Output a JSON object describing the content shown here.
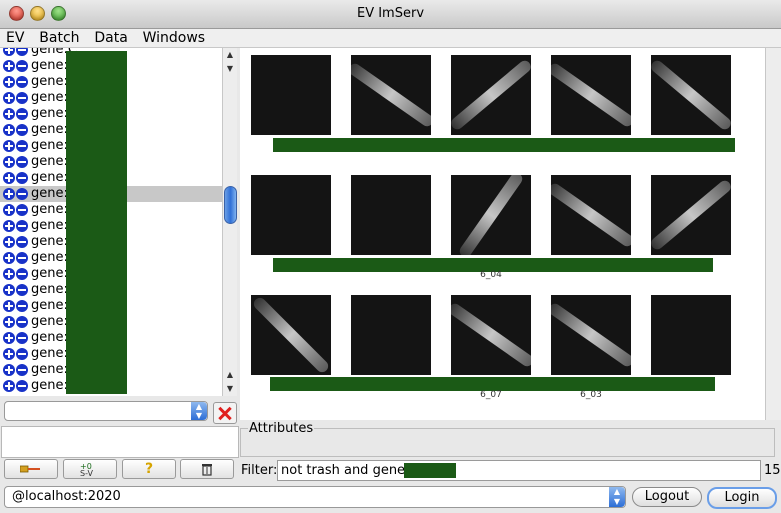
{
  "window": {
    "title": "EV ImServ"
  },
  "menu": [
    "EV",
    "Batch",
    "Data",
    "Windows"
  ],
  "gene_list": {
    "rows": [
      {
        "label": "gene:C",
        "selected": false
      },
      {
        "label": "gene:C",
        "selected": false
      },
      {
        "label": "gene:C",
        "selected": false
      },
      {
        "label": "gene:C",
        "selected": false
      },
      {
        "label": "gene:C",
        "selected": false
      },
      {
        "label": "gene:C",
        "selected": false
      },
      {
        "label": "gene:C",
        "selected": false
      },
      {
        "label": "gene:C",
        "selected": false
      },
      {
        "label": "gene:C",
        "selected": false
      },
      {
        "label": "gene:E",
        "selected": true
      },
      {
        "label": "gene:E",
        "selected": false
      },
      {
        "label": "gene:E",
        "selected": false
      },
      {
        "label": "gene:E",
        "selected": false
      },
      {
        "label": "gene:E",
        "selected": false
      },
      {
        "label": "gene:E",
        "selected": false
      },
      {
        "label": "gene:E",
        "selected": false
      },
      {
        "label": "gene:E",
        "selected": false
      },
      {
        "label": "gene:E",
        "selected": false
      },
      {
        "label": "gene:E",
        "selected": false
      },
      {
        "label": "gene:E",
        "selected": false
      },
      {
        "label": "gene:E",
        "selected": false
      },
      {
        "label": "gene:E",
        "selected": false
      }
    ]
  },
  "thumbnails": {
    "row_captions": [
      "",
      "6_04",
      "6_07",
      "6_03"
    ],
    "images": [
      {
        "worm": false,
        "angle": 0
      },
      {
        "worm": true,
        "angle": 35
      },
      {
        "worm": true,
        "angle": -40
      },
      {
        "worm": true,
        "angle": 35
      },
      {
        "worm": true,
        "angle": 40
      },
      {
        "worm": false,
        "angle": 0
      },
      {
        "worm": false,
        "angle": 0
      },
      {
        "worm": true,
        "angle": -55
      },
      {
        "worm": true,
        "angle": 35
      },
      {
        "worm": true,
        "angle": -40
      },
      {
        "worm": true,
        "angle": 45
      },
      {
        "worm": false,
        "angle": 0
      },
      {
        "worm": true,
        "angle": 35
      },
      {
        "worm": true,
        "angle": 35
      },
      {
        "worm": false,
        "angle": 0
      }
    ]
  },
  "attributes": {
    "title": "Attributes"
  },
  "toolbar": {
    "tag_icon": "tag-icon",
    "sort_icon": "sort-icon",
    "help_label": "?",
    "trash_icon": "trash-icon"
  },
  "filter": {
    "label": "Filter:",
    "value": "not trash and gene:E",
    "count": "15"
  },
  "server": {
    "value": "@localhost:2020"
  },
  "buttons": {
    "logout": "Logout",
    "login": "Login"
  }
}
